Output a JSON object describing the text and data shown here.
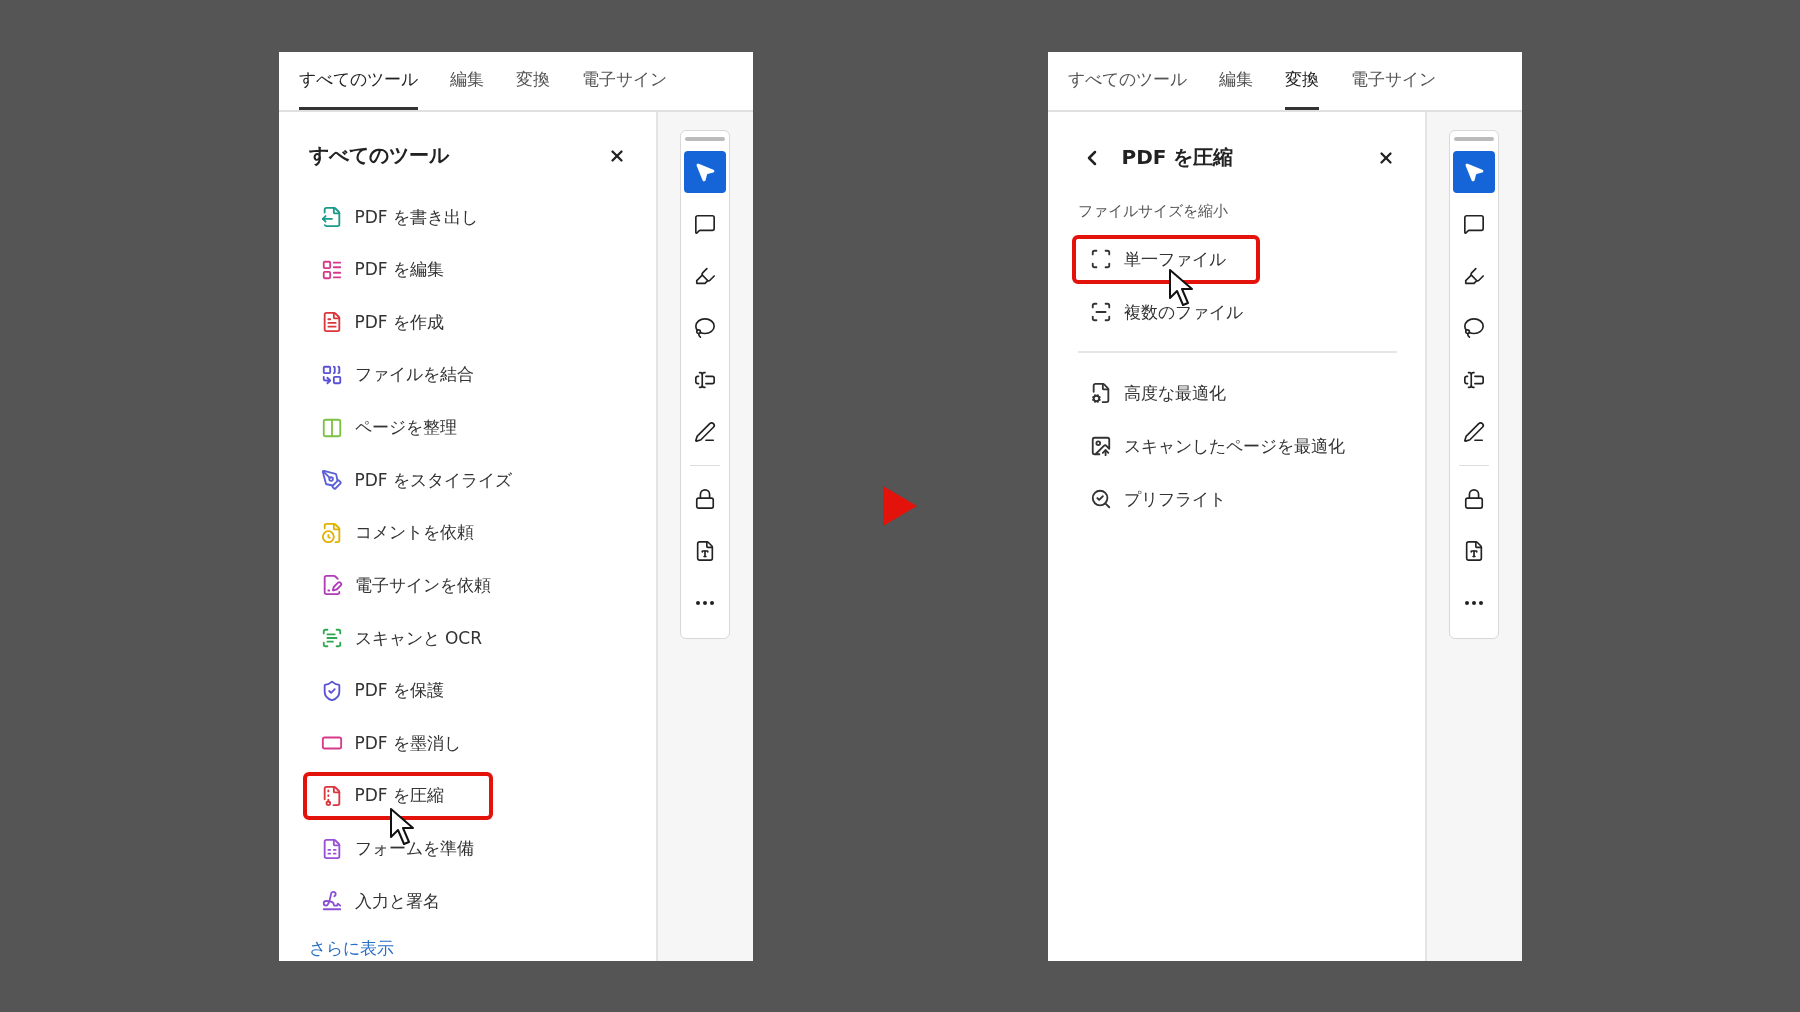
{
  "panels": [
    {
      "tabs": [
        {
          "label": "すべてのツール",
          "selected": true
        },
        {
          "label": "編集",
          "selected": false
        },
        {
          "label": "変換",
          "selected": false
        },
        {
          "label": "電子サイン",
          "selected": false
        }
      ],
      "header": {
        "title": "すべてのツール",
        "back": false
      },
      "groups": [
        {
          "items": [
            {
              "label": "PDF を書き出し",
              "color": "#1a9a8a",
              "highlighted": false
            },
            {
              "label": "PDF を編集",
              "color": "#d6398a",
              "highlighted": false
            },
            {
              "label": "PDF を作成",
              "color": "#d9363e",
              "highlighted": false
            },
            {
              "label": "ファイルを結合",
              "color": "#5a52d6",
              "highlighted": false
            },
            {
              "label": "ページを整理",
              "color": "#7cc142",
              "highlighted": false
            },
            {
              "label": "PDF をスタイライズ",
              "color": "#5b5fd8",
              "highlighted": false
            },
            {
              "label": "コメントを依頼",
              "color": "#e0b100",
              "highlighted": false
            },
            {
              "label": "電子サインを依頼",
              "color": "#b03ab8",
              "highlighted": false
            },
            {
              "label": "スキャンと OCR",
              "color": "#2fa84f",
              "highlighted": false
            },
            {
              "label": "PDF を保護",
              "color": "#5952d4",
              "highlighted": false
            },
            {
              "label": "PDF を墨消し",
              "color": "#d6398a",
              "highlighted": false
            },
            {
              "label": "PDF を圧縮",
              "color": "#d9363e",
              "highlighted": true
            },
            {
              "label": "フォームを準備",
              "color": "#9b4fd6",
              "highlighted": false
            },
            {
              "label": "入力と署名",
              "color": "#8a4fd6",
              "highlighted": false
            }
          ]
        }
      ],
      "more_link": "さらに表示",
      "toolbar": [
        {
          "kind": "select",
          "selected": true
        },
        {
          "kind": "comment",
          "selected": false
        },
        {
          "kind": "highlight",
          "selected": false
        },
        {
          "kind": "draw",
          "selected": false
        },
        {
          "kind": "textbox",
          "selected": false
        },
        {
          "kind": "sign",
          "selected": false
        },
        {
          "kind": "protect",
          "selected": false
        },
        {
          "kind": "document",
          "selected": false
        },
        {
          "kind": "more",
          "selected": false
        }
      ]
    },
    {
      "tabs": [
        {
          "label": "すべてのツール",
          "selected": false
        },
        {
          "label": "編集",
          "selected": false
        },
        {
          "label": "変換",
          "selected": true
        },
        {
          "label": "電子サイン",
          "selected": false
        }
      ],
      "header": {
        "title": "PDF を圧縮",
        "back": true
      },
      "groups": [
        {
          "label": "ファイルサイズを縮小",
          "items": [
            {
              "label": "単一ファイル",
              "highlighted": true
            },
            {
              "label": "複数のファイル",
              "highlighted": false
            }
          ]
        },
        {
          "items": [
            {
              "label": "高度な最適化",
              "highlighted": false
            },
            {
              "label": "スキャンしたページを最適化",
              "highlighted": false
            },
            {
              "label": "プリフライト",
              "highlighted": false
            }
          ]
        }
      ],
      "toolbar": [
        {
          "kind": "select",
          "selected": true
        },
        {
          "kind": "comment",
          "selected": false
        },
        {
          "kind": "highlight",
          "selected": false
        },
        {
          "kind": "draw",
          "selected": false
        },
        {
          "kind": "textbox",
          "selected": false
        },
        {
          "kind": "sign",
          "selected": false
        },
        {
          "kind": "protect",
          "selected": false
        },
        {
          "kind": "document",
          "selected": false
        },
        {
          "kind": "more",
          "selected": false
        }
      ]
    }
  ]
}
